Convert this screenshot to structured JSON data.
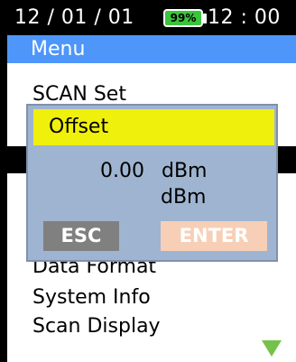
{
  "status": {
    "date": "12 / 01 / 01",
    "battery": "99%",
    "time": "12 : 00"
  },
  "menu": {
    "title": "Menu",
    "items": [
      "SCAN Set",
      "Data Format",
      "System Info",
      "Scan Display"
    ]
  },
  "dialog": {
    "title": "Offset",
    "value": "0.00",
    "unit": "dBm",
    "unit_secondary": "dBm",
    "esc_label": "ESC",
    "enter_label": "ENTER"
  },
  "colors": {
    "menu_header": "#4e96fa",
    "dialog_title": "#f0f00d",
    "battery": "#3dc43d",
    "scroll_arrow": "#74c24a"
  },
  "icons": {
    "scroll": "triangle-down-icon",
    "battery": "battery-icon"
  }
}
